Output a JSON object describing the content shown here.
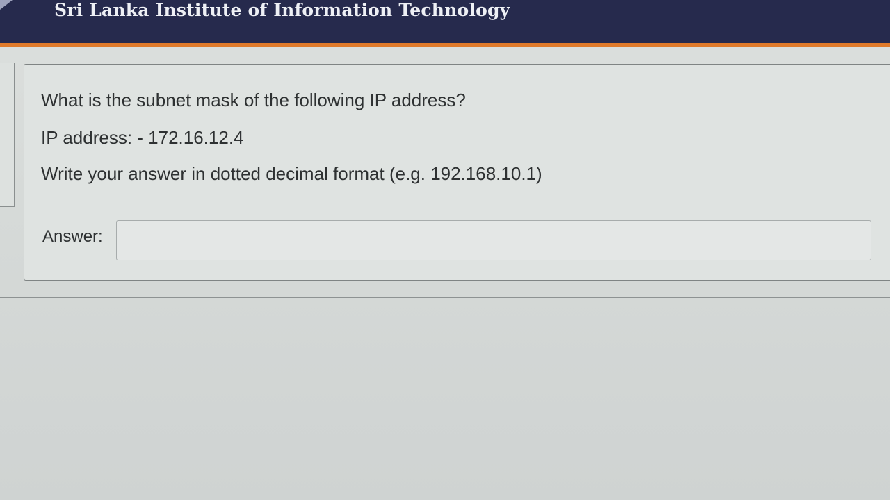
{
  "header": {
    "title": "Sri Lanka Institute of Information Technology"
  },
  "question": {
    "text": "What is the subnet mask of the following IP address?",
    "ip_line": "IP address: - 172.16.12.4",
    "instruction": "Write your answer in dotted decimal format (e.g. 192.168.10.1)"
  },
  "answer": {
    "label": "Answer:",
    "value": ""
  },
  "colors": {
    "header_bg": "#262a4d",
    "accent": "#e07a2a",
    "page_bg": "#d6dad8"
  }
}
